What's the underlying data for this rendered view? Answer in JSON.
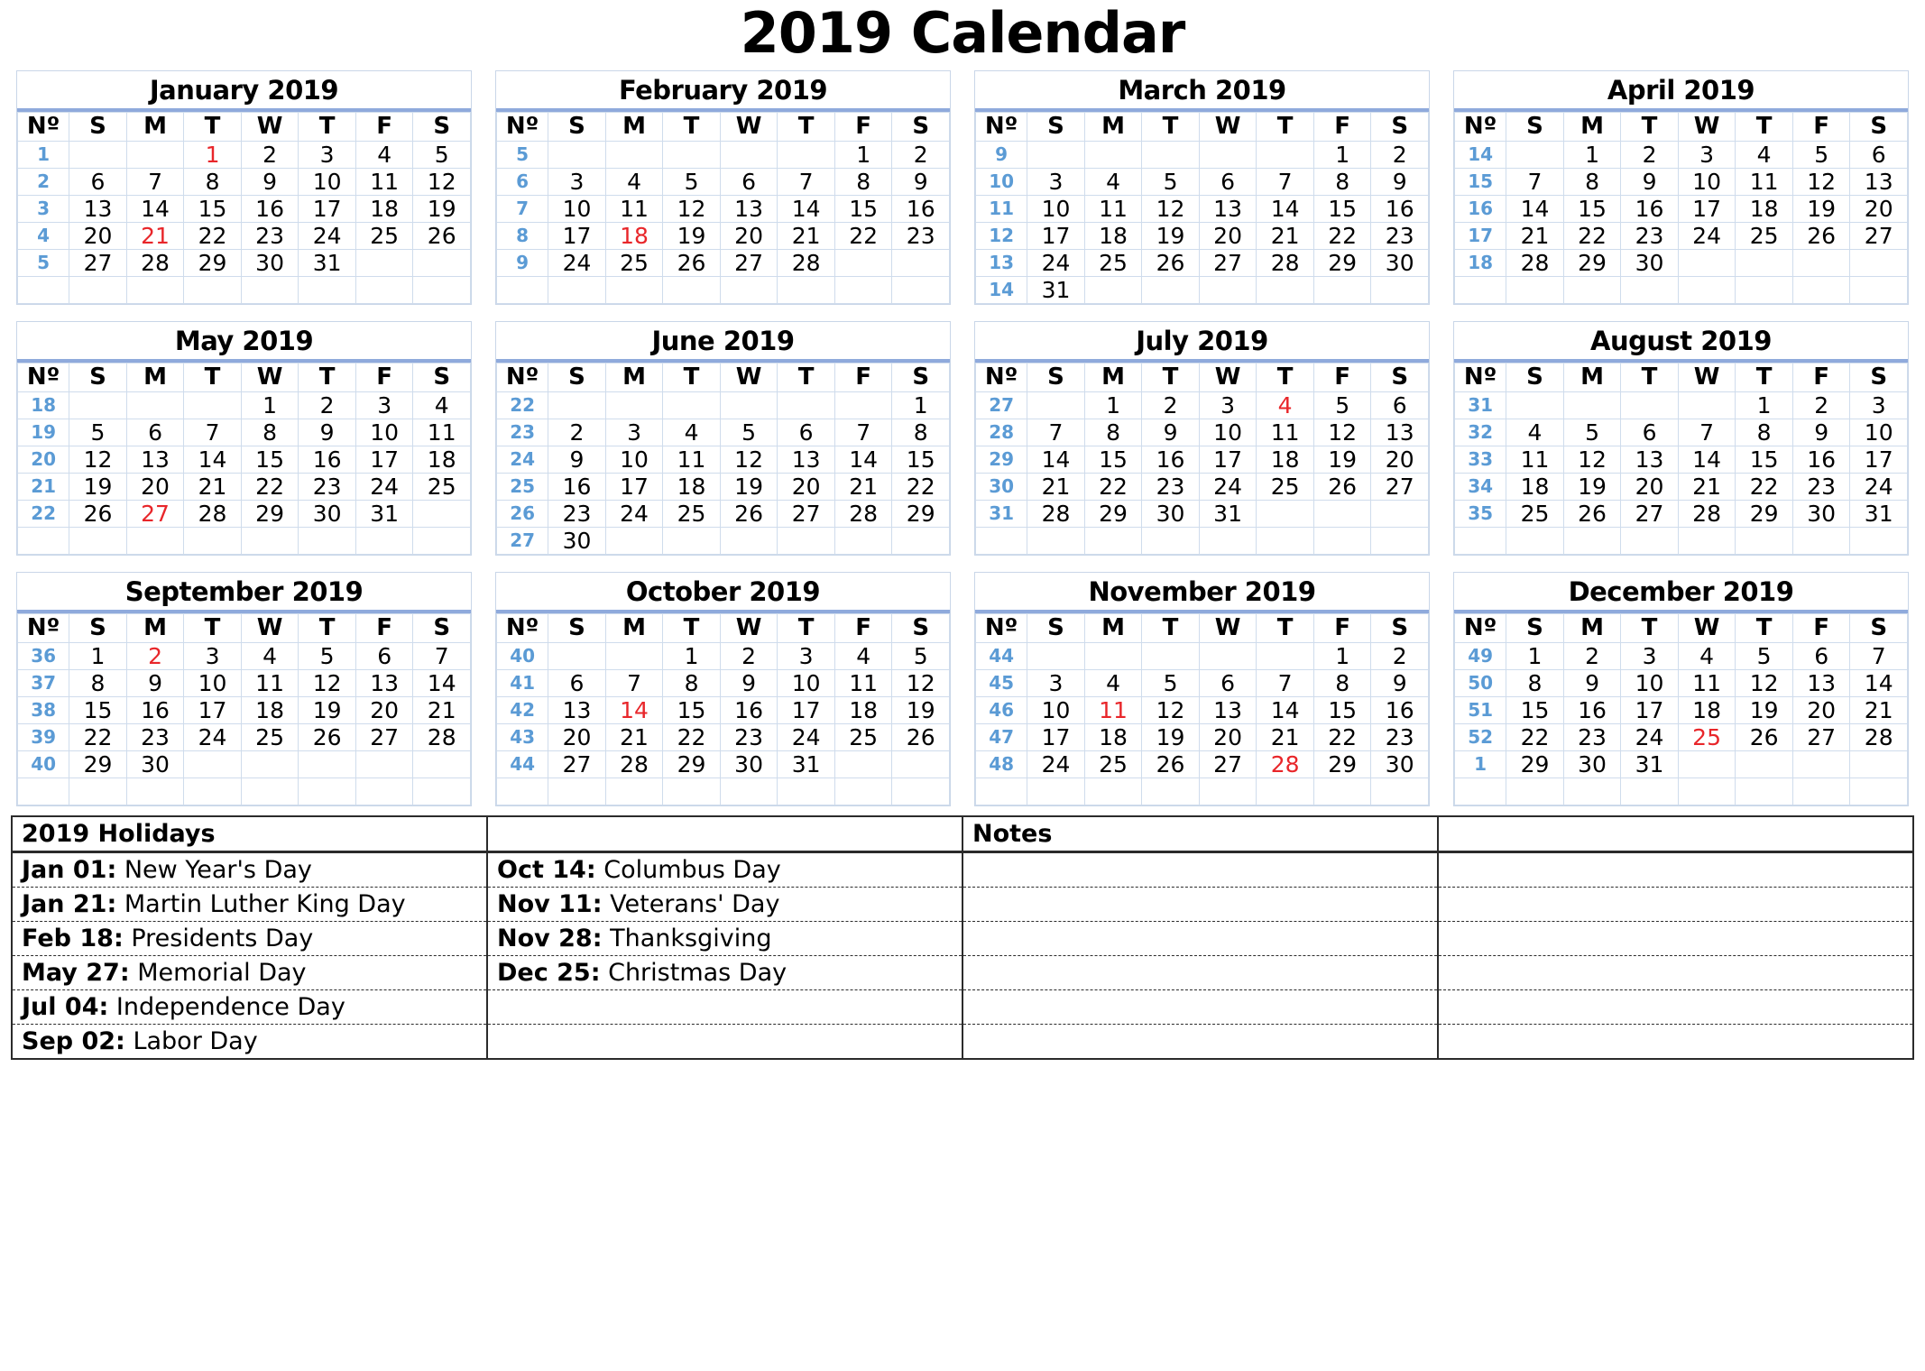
{
  "title": "2019 Calendar",
  "colors": {
    "holiday_red": "#e8262a",
    "week_number_blue": "#5b9bd5",
    "rule_blue": "#8faadc",
    "grid_blue": "#cfdcec"
  },
  "weekday_headers": [
    "Nº",
    "S",
    "M",
    "T",
    "W",
    "T",
    "F",
    "S"
  ],
  "week_col_header": "Nº",
  "months": [
    {
      "name": "January 2019",
      "weeks": [
        {
          "no": "1",
          "days": [
            "",
            "",
            "1",
            "2",
            "3",
            "4",
            "5"
          ],
          "holidays": [
            "1"
          ]
        },
        {
          "no": "2",
          "days": [
            "6",
            "7",
            "8",
            "9",
            "10",
            "11",
            "12"
          ],
          "holidays": []
        },
        {
          "no": "3",
          "days": [
            "13",
            "14",
            "15",
            "16",
            "17",
            "18",
            "19"
          ],
          "holidays": []
        },
        {
          "no": "4",
          "days": [
            "20",
            "21",
            "22",
            "23",
            "24",
            "25",
            "26"
          ],
          "holidays": [
            "21"
          ]
        },
        {
          "no": "5",
          "days": [
            "27",
            "28",
            "29",
            "30",
            "31",
            "",
            ""
          ],
          "holidays": []
        },
        {
          "no": "",
          "days": [
            "",
            "",
            "",
            "",
            "",
            "",
            ""
          ],
          "holidays": []
        }
      ]
    },
    {
      "name": "February 2019",
      "weeks": [
        {
          "no": "5",
          "days": [
            "",
            "",
            "",
            "",
            "",
            "1",
            "2"
          ],
          "holidays": []
        },
        {
          "no": "6",
          "days": [
            "3",
            "4",
            "5",
            "6",
            "7",
            "8",
            "9"
          ],
          "holidays": []
        },
        {
          "no": "7",
          "days": [
            "10",
            "11",
            "12",
            "13",
            "14",
            "15",
            "16"
          ],
          "holidays": []
        },
        {
          "no": "8",
          "days": [
            "17",
            "18",
            "19",
            "20",
            "21",
            "22",
            "23"
          ],
          "holidays": [
            "18"
          ]
        },
        {
          "no": "9",
          "days": [
            "24",
            "25",
            "26",
            "27",
            "28",
            "",
            ""
          ],
          "holidays": []
        },
        {
          "no": "",
          "days": [
            "",
            "",
            "",
            "",
            "",
            "",
            ""
          ],
          "holidays": []
        }
      ]
    },
    {
      "name": "March 2019",
      "weeks": [
        {
          "no": "9",
          "days": [
            "",
            "",
            "",
            "",
            "",
            "1",
            "2"
          ],
          "holidays": []
        },
        {
          "no": "10",
          "days": [
            "3",
            "4",
            "5",
            "6",
            "7",
            "8",
            "9"
          ],
          "holidays": []
        },
        {
          "no": "11",
          "days": [
            "10",
            "11",
            "12",
            "13",
            "14",
            "15",
            "16"
          ],
          "holidays": []
        },
        {
          "no": "12",
          "days": [
            "17",
            "18",
            "19",
            "20",
            "21",
            "22",
            "23"
          ],
          "holidays": []
        },
        {
          "no": "13",
          "days": [
            "24",
            "25",
            "26",
            "27",
            "28",
            "29",
            "30"
          ],
          "holidays": []
        },
        {
          "no": "14",
          "days": [
            "31",
            "",
            "",
            "",
            "",
            "",
            ""
          ],
          "holidays": []
        }
      ]
    },
    {
      "name": "April 2019",
      "weeks": [
        {
          "no": "14",
          "days": [
            "",
            "1",
            "2",
            "3",
            "4",
            "5",
            "6"
          ],
          "holidays": []
        },
        {
          "no": "15",
          "days": [
            "7",
            "8",
            "9",
            "10",
            "11",
            "12",
            "13"
          ],
          "holidays": []
        },
        {
          "no": "16",
          "days": [
            "14",
            "15",
            "16",
            "17",
            "18",
            "19",
            "20"
          ],
          "holidays": []
        },
        {
          "no": "17",
          "days": [
            "21",
            "22",
            "23",
            "24",
            "25",
            "26",
            "27"
          ],
          "holidays": []
        },
        {
          "no": "18",
          "days": [
            "28",
            "29",
            "30",
            "",
            "",
            "",
            ""
          ],
          "holidays": []
        },
        {
          "no": "",
          "days": [
            "",
            "",
            "",
            "",
            "",
            "",
            ""
          ],
          "holidays": []
        }
      ]
    },
    {
      "name": "May 2019",
      "weeks": [
        {
          "no": "18",
          "days": [
            "",
            "",
            "",
            "1",
            "2",
            "3",
            "4"
          ],
          "holidays": []
        },
        {
          "no": "19",
          "days": [
            "5",
            "6",
            "7",
            "8",
            "9",
            "10",
            "11"
          ],
          "holidays": []
        },
        {
          "no": "20",
          "days": [
            "12",
            "13",
            "14",
            "15",
            "16",
            "17",
            "18"
          ],
          "holidays": []
        },
        {
          "no": "21",
          "days": [
            "19",
            "20",
            "21",
            "22",
            "23",
            "24",
            "25"
          ],
          "holidays": []
        },
        {
          "no": "22",
          "days": [
            "26",
            "27",
            "28",
            "29",
            "30",
            "31",
            ""
          ],
          "holidays": [
            "27"
          ]
        },
        {
          "no": "",
          "days": [
            "",
            "",
            "",
            "",
            "",
            "",
            ""
          ],
          "holidays": []
        }
      ]
    },
    {
      "name": "June 2019",
      "weeks": [
        {
          "no": "22",
          "days": [
            "",
            "",
            "",
            "",
            "",
            "",
            "1"
          ],
          "holidays": []
        },
        {
          "no": "23",
          "days": [
            "2",
            "3",
            "4",
            "5",
            "6",
            "7",
            "8"
          ],
          "holidays": []
        },
        {
          "no": "24",
          "days": [
            "9",
            "10",
            "11",
            "12",
            "13",
            "14",
            "15"
          ],
          "holidays": []
        },
        {
          "no": "25",
          "days": [
            "16",
            "17",
            "18",
            "19",
            "20",
            "21",
            "22"
          ],
          "holidays": []
        },
        {
          "no": "26",
          "days": [
            "23",
            "24",
            "25",
            "26",
            "27",
            "28",
            "29"
          ],
          "holidays": []
        },
        {
          "no": "27",
          "days": [
            "30",
            "",
            "",
            "",
            "",
            "",
            ""
          ],
          "holidays": []
        }
      ]
    },
    {
      "name": "July 2019",
      "weeks": [
        {
          "no": "27",
          "days": [
            "",
            "1",
            "2",
            "3",
            "4",
            "5",
            "6"
          ],
          "holidays": [
            "4"
          ]
        },
        {
          "no": "28",
          "days": [
            "7",
            "8",
            "9",
            "10",
            "11",
            "12",
            "13"
          ],
          "holidays": []
        },
        {
          "no": "29",
          "days": [
            "14",
            "15",
            "16",
            "17",
            "18",
            "19",
            "20"
          ],
          "holidays": []
        },
        {
          "no": "30",
          "days": [
            "21",
            "22",
            "23",
            "24",
            "25",
            "26",
            "27"
          ],
          "holidays": []
        },
        {
          "no": "31",
          "days": [
            "28",
            "29",
            "30",
            "31",
            "",
            "",
            ""
          ],
          "holidays": []
        },
        {
          "no": "",
          "days": [
            "",
            "",
            "",
            "",
            "",
            "",
            ""
          ],
          "holidays": []
        }
      ]
    },
    {
      "name": "August 2019",
      "weeks": [
        {
          "no": "31",
          "days": [
            "",
            "",
            "",
            "",
            "1",
            "2",
            "3"
          ],
          "holidays": []
        },
        {
          "no": "32",
          "days": [
            "4",
            "5",
            "6",
            "7",
            "8",
            "9",
            "10"
          ],
          "holidays": []
        },
        {
          "no": "33",
          "days": [
            "11",
            "12",
            "13",
            "14",
            "15",
            "16",
            "17"
          ],
          "holidays": []
        },
        {
          "no": "34",
          "days": [
            "18",
            "19",
            "20",
            "21",
            "22",
            "23",
            "24"
          ],
          "holidays": []
        },
        {
          "no": "35",
          "days": [
            "25",
            "26",
            "27",
            "28",
            "29",
            "30",
            "31"
          ],
          "holidays": []
        },
        {
          "no": "",
          "days": [
            "",
            "",
            "",
            "",
            "",
            "",
            ""
          ],
          "holidays": []
        }
      ]
    },
    {
      "name": "September 2019",
      "weeks": [
        {
          "no": "36",
          "days": [
            "1",
            "2",
            "3",
            "4",
            "5",
            "6",
            "7"
          ],
          "holidays": [
            "2"
          ]
        },
        {
          "no": "37",
          "days": [
            "8",
            "9",
            "10",
            "11",
            "12",
            "13",
            "14"
          ],
          "holidays": []
        },
        {
          "no": "38",
          "days": [
            "15",
            "16",
            "17",
            "18",
            "19",
            "20",
            "21"
          ],
          "holidays": []
        },
        {
          "no": "39",
          "days": [
            "22",
            "23",
            "24",
            "25",
            "26",
            "27",
            "28"
          ],
          "holidays": []
        },
        {
          "no": "40",
          "days": [
            "29",
            "30",
            "",
            "",
            "",
            "",
            ""
          ],
          "holidays": []
        },
        {
          "no": "",
          "days": [
            "",
            "",
            "",
            "",
            "",
            "",
            ""
          ],
          "holidays": []
        }
      ]
    },
    {
      "name": "October 2019",
      "weeks": [
        {
          "no": "40",
          "days": [
            "",
            "",
            "1",
            "2",
            "3",
            "4",
            "5"
          ],
          "holidays": []
        },
        {
          "no": "41",
          "days": [
            "6",
            "7",
            "8",
            "9",
            "10",
            "11",
            "12"
          ],
          "holidays": []
        },
        {
          "no": "42",
          "days": [
            "13",
            "14",
            "15",
            "16",
            "17",
            "18",
            "19"
          ],
          "holidays": [
            "14"
          ]
        },
        {
          "no": "43",
          "days": [
            "20",
            "21",
            "22",
            "23",
            "24",
            "25",
            "26"
          ],
          "holidays": []
        },
        {
          "no": "44",
          "days": [
            "27",
            "28",
            "29",
            "30",
            "31",
            "",
            ""
          ],
          "holidays": []
        },
        {
          "no": "",
          "days": [
            "",
            "",
            "",
            "",
            "",
            "",
            ""
          ],
          "holidays": []
        }
      ]
    },
    {
      "name": "November 2019",
      "weeks": [
        {
          "no": "44",
          "days": [
            "",
            "",
            "",
            "",
            "",
            "1",
            "2"
          ],
          "holidays": []
        },
        {
          "no": "45",
          "days": [
            "3",
            "4",
            "5",
            "6",
            "7",
            "8",
            "9"
          ],
          "holidays": []
        },
        {
          "no": "46",
          "days": [
            "10",
            "11",
            "12",
            "13",
            "14",
            "15",
            "16"
          ],
          "holidays": [
            "11"
          ]
        },
        {
          "no": "47",
          "days": [
            "17",
            "18",
            "19",
            "20",
            "21",
            "22",
            "23"
          ],
          "holidays": []
        },
        {
          "no": "48",
          "days": [
            "24",
            "25",
            "26",
            "27",
            "28",
            "29",
            "30"
          ],
          "holidays": [
            "28"
          ]
        },
        {
          "no": "",
          "days": [
            "",
            "",
            "",
            "",
            "",
            "",
            ""
          ],
          "holidays": []
        }
      ]
    },
    {
      "name": "December 2019",
      "weeks": [
        {
          "no": "49",
          "days": [
            "1",
            "2",
            "3",
            "4",
            "5",
            "6",
            "7"
          ],
          "holidays": []
        },
        {
          "no": "50",
          "days": [
            "8",
            "9",
            "10",
            "11",
            "12",
            "13",
            "14"
          ],
          "holidays": []
        },
        {
          "no": "51",
          "days": [
            "15",
            "16",
            "17",
            "18",
            "19",
            "20",
            "21"
          ],
          "holidays": []
        },
        {
          "no": "52",
          "days": [
            "22",
            "23",
            "24",
            "25",
            "26",
            "27",
            "28"
          ],
          "holidays": [
            "25"
          ]
        },
        {
          "no": "1",
          "days": [
            "29",
            "30",
            "31",
            "",
            "",
            "",
            ""
          ],
          "holidays": []
        },
        {
          "no": "",
          "days": [
            "",
            "",
            "",
            "",
            "",
            "",
            ""
          ],
          "holidays": []
        }
      ]
    }
  ],
  "bottom_table": {
    "holidays_header": "2019 Holidays",
    "notes_header": "Notes",
    "rows": [
      {
        "col1": {
          "date": "Jan 01:",
          "name": "New Year's Day"
        },
        "col2": {
          "date": "Oct 14:",
          "name": "Columbus Day"
        }
      },
      {
        "col1": {
          "date": "Jan 21:",
          "name": "Martin Luther King Day"
        },
        "col2": {
          "date": "Nov 11:",
          "name": "Veterans' Day"
        }
      },
      {
        "col1": {
          "date": "Feb 18:",
          "name": "Presidents Day"
        },
        "col2": {
          "date": "Nov 28:",
          "name": "Thanksgiving"
        }
      },
      {
        "col1": {
          "date": "May 27:",
          "name": "Memorial Day"
        },
        "col2": {
          "date": "Dec 25:",
          "name": "Christmas Day"
        }
      },
      {
        "col1": {
          "date": "Jul 04:",
          "name": "Independence Day"
        },
        "col2": {
          "date": "",
          "name": ""
        }
      },
      {
        "col1": {
          "date": "Sep 02:",
          "name": "Labor Day"
        },
        "col2": {
          "date": "",
          "name": ""
        }
      }
    ]
  }
}
